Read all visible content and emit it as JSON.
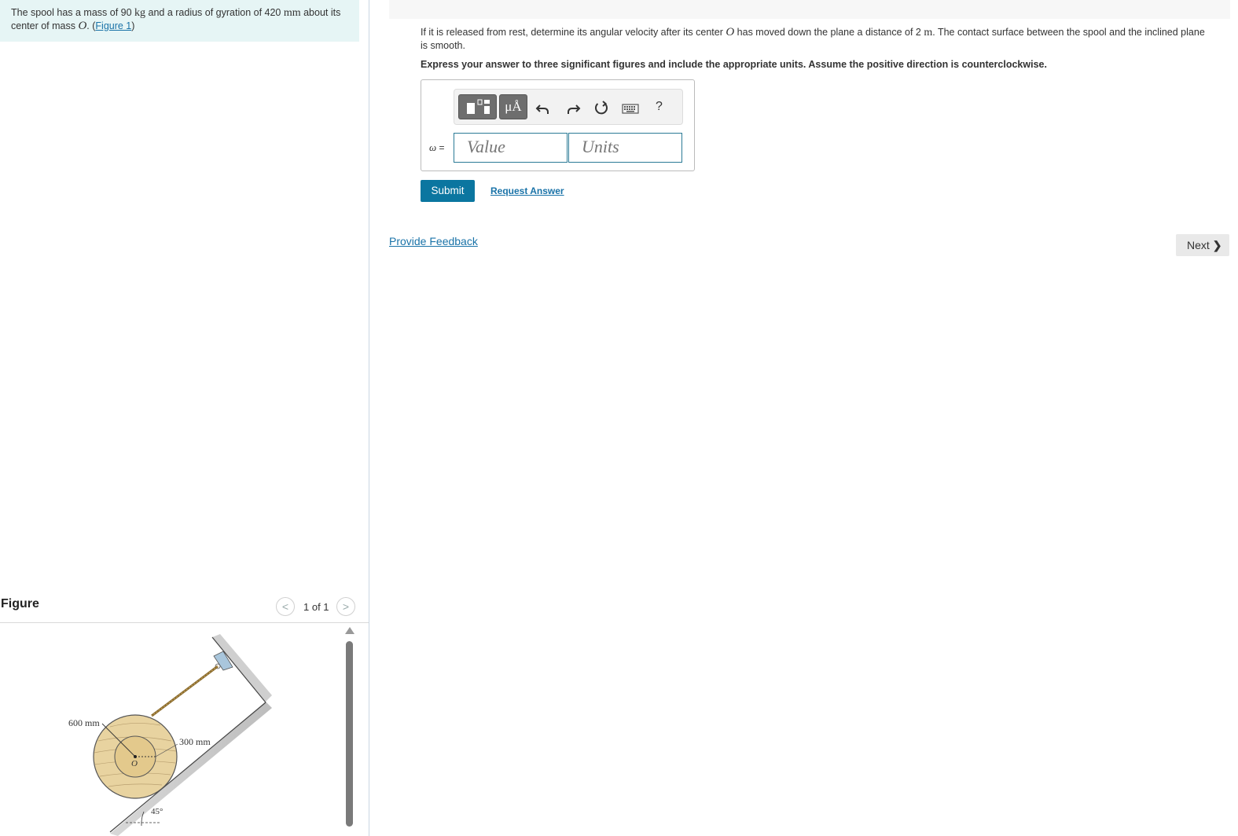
{
  "intro": {
    "text_1": "The spool has a mass of 90 ",
    "unit_kg": "kg",
    "text_2": " and a radius of gyration of 420 ",
    "unit_mm": "mm",
    "text_3": " about its center of mass ",
    "symbol_O": "O",
    "text_4": ". (",
    "figure_link": "Figure 1",
    "text_5": ")"
  },
  "figure_panel": {
    "title": "Figure",
    "counter": "1 of 1",
    "prev_glyph": "<",
    "next_glyph": ">",
    "labels": {
      "outer_radius": "600 mm",
      "inner_radius": "300 mm",
      "center": "O",
      "angle": "45°"
    }
  },
  "question": {
    "text_1": "If it is released from rest, determine its angular velocity after its center ",
    "symbol_O": "O",
    "text_2": " has moved down the plane a distance of 2 ",
    "unit_m": "m",
    "text_3": ". The contact surface between the spool and the inclined plane is smooth."
  },
  "instruction": "Express your answer to three significant figures and include the appropriate units. Assume the positive direction is counterclockwise.",
  "answer": {
    "variable": "ω",
    "equals": " =",
    "value_placeholder": "Value",
    "units_placeholder": "Units",
    "toolbar": {
      "units_label": "μÅ",
      "help_label": "?",
      "icons": [
        "templates-icon",
        "units-icon",
        "undo-icon",
        "redo-icon",
        "reset-icon",
        "keyboard-icon",
        "help-icon"
      ]
    }
  },
  "actions": {
    "submit": "Submit",
    "request_answer": "Request Answer",
    "provide_feedback": "Provide Feedback",
    "next": "Next",
    "next_glyph": "❯"
  },
  "colors": {
    "accent": "#0b76a0",
    "link": "#1a73a8",
    "intro_bg": "#e6f5f5",
    "spool_fill": "#e8d3a0"
  }
}
